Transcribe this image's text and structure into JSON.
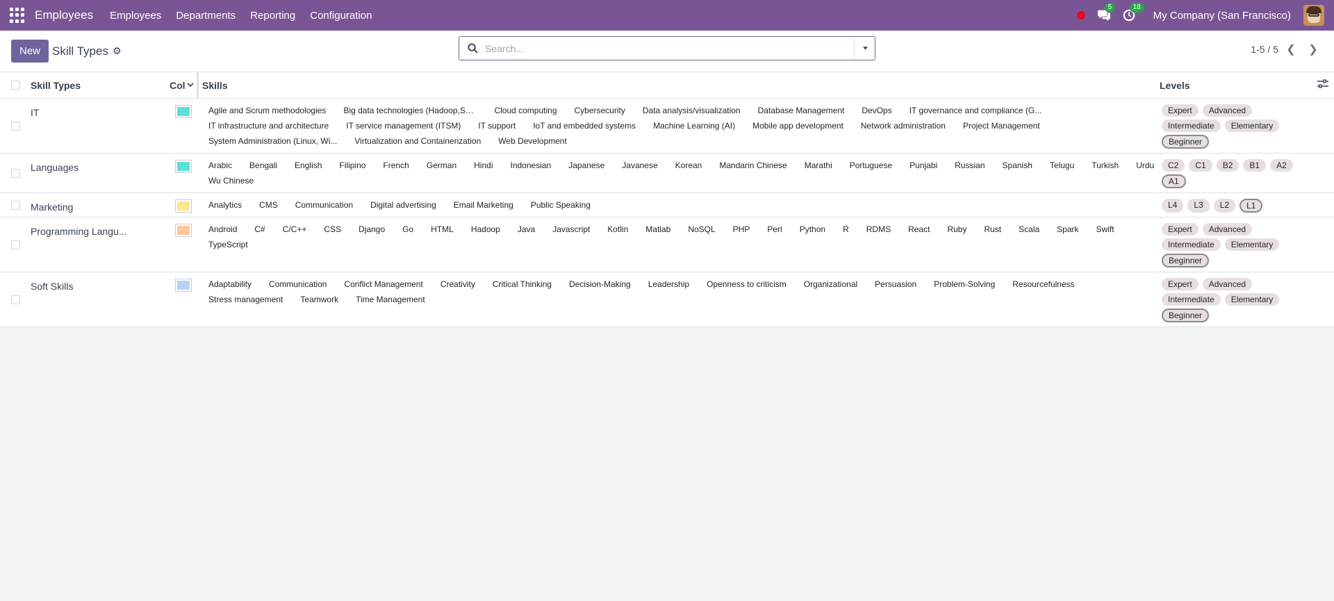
{
  "topbar": {
    "app_name": "Employees",
    "menu": [
      "Employees",
      "Departments",
      "Reporting",
      "Configuration"
    ],
    "messages_count": "5",
    "activities_count": "18",
    "company": "My Company (San Francisco)"
  },
  "control": {
    "new_label": "New",
    "title": "Skill Types",
    "search_placeholder": "Search...",
    "pager": "1-5 / 5"
  },
  "table": {
    "headers": {
      "type": "Skill Types",
      "color": "Col",
      "skills": "Skills",
      "levels": "Levels"
    },
    "rows": [
      {
        "name": "IT",
        "color": "#5ce1d9",
        "skills": [
          "Agile and Scrum methodologies",
          "Big data technologies (Hadoop,Sp...",
          "Cloud computing",
          "Cybersecurity",
          "Data analysis/visualization",
          "Database Management",
          "DevOps",
          "IT governance and compliance (G...",
          "IT infrastructure and architecture",
          "IT service management (ITSM)",
          "IT support",
          "IoT and embedded systems",
          "Machine Learning (AI)",
          "Mobile app development",
          "Network administration",
          "Project Management",
          "System Administration (Linux, Wi...",
          "Virtualization and Containerization",
          "Web Development"
        ],
        "levels": [
          "Expert",
          "Advanced",
          "Intermediate",
          "Elementary",
          "Beginner"
        ],
        "default_level": "Beginner"
      },
      {
        "name": "Languages",
        "color": "#5ce1d9",
        "skills": [
          "Arabic",
          "Bengali",
          "English",
          "Filipino",
          "French",
          "German",
          "Hindi",
          "Indonesian",
          "Japanese",
          "Javanese",
          "Korean",
          "Mandarin Chinese",
          "Marathi",
          "Portuguese",
          "Punjabi",
          "Russian",
          "Spanish",
          "Telugu",
          "Turkish",
          "Urdu",
          "Wu Chinese"
        ],
        "levels": [
          "C2",
          "C1",
          "B2",
          "B1",
          "A2",
          "A1"
        ],
        "default_level": "A1"
      },
      {
        "name": "Marketing",
        "color": "#ffe58f",
        "skills": [
          "Analytics",
          "CMS",
          "Communication",
          "Digital advertising",
          "Email Marketing",
          "Public Speaking"
        ],
        "levels": [
          "L4",
          "L3",
          "L2",
          "L1"
        ],
        "default_level": "L1"
      },
      {
        "name": "Programming Langu...",
        "color": "#ffc59b",
        "skills": [
          "Android",
          "C#",
          "C/C++",
          "CSS",
          "Django",
          "Go",
          "HTML",
          "Hadoop",
          "Java",
          "Javascript",
          "Kotlin",
          "Matlab",
          "NoSQL",
          "PHP",
          "Perl",
          "Python",
          "R",
          "RDMS",
          "React",
          "Ruby",
          "Rust",
          "Scala",
          "Spark",
          "Swift",
          "TypeScript"
        ],
        "levels": [
          "Expert",
          "Advanced",
          "Intermediate",
          "Elementary",
          "Beginner"
        ],
        "default_level": "Beginner"
      },
      {
        "name": "Soft Skills",
        "color": "#b3d4fa",
        "skills": [
          "Adaptability",
          "Communication",
          "Conflict Management",
          "Creativity",
          "Critical Thinking",
          "Decision-Making",
          "Leadership",
          "Openness to criticism",
          "Organizational",
          "Persuasion",
          "Problem-Solving",
          "Resourcefulness",
          "Stress management",
          "Teamwork",
          "Time Management"
        ],
        "levels": [
          "Expert",
          "Advanced",
          "Intermediate",
          "Elementary",
          "Beginner"
        ],
        "default_level": "Beginner"
      }
    ]
  }
}
